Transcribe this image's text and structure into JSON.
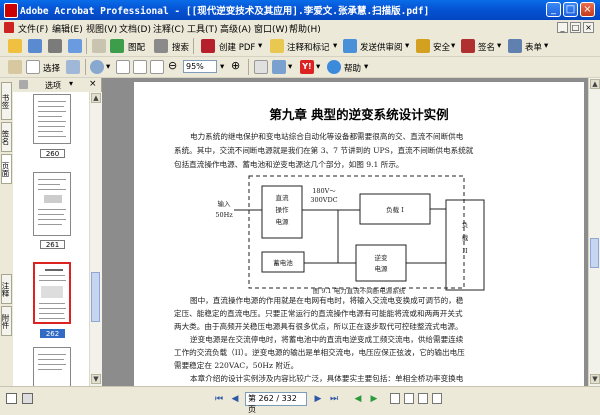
{
  "window": {
    "title": "Adobe Acrobat Professional - [[现代逆变技术及其应用].李爱文.张承慧.扫描版.pdf]",
    "minimize": "_",
    "maximize": "□",
    "close": "×"
  },
  "menus": [
    "文件(F)",
    "编辑(E)",
    "视图(V)",
    "文档(D)",
    "注释(C)",
    "工具(T)",
    "高级(A)",
    "窗口(W)",
    "帮助(H)"
  ],
  "mdi": {
    "minimize": "_",
    "restore": "□",
    "close": "×"
  },
  "toolbar1": {
    "create_pdf": "创建 PDF",
    "comment": "注释和标记",
    "send_review": "发送供审阅",
    "secure": "安全",
    "sign": "签名",
    "forms": "表单",
    "organize": "图配",
    "search": "搜索"
  },
  "toolbar2": {
    "select": "选择",
    "zoom_value": "95%",
    "help": "帮助"
  },
  "side_tabs": [
    "书签",
    "签名",
    "页面",
    "注释",
    "附件"
  ],
  "panel": {
    "options": "选项"
  },
  "thumbnails": [
    {
      "label": "260"
    },
    {
      "label": "261"
    },
    {
      "label": "262",
      "selected": true
    }
  ],
  "page": {
    "title": "第九章   典型的逆变系统设计实例",
    "para1": [
      "电力系统的继电保护和变电站综合自动化等设备都需要很高的交、直流不间断供电",
      "系统。其中，交流不间断电源就是我们在第 3、7 节讲到的 UPS，直流不间断供电系统就",
      "包括直流操作电源、蓄电池和逆变电源这几个部分，如图 9.1 所示。"
    ],
    "diagram": {
      "input": [
        "输入",
        "50Hz"
      ],
      "operate": [
        "直流",
        "操作",
        "电源"
      ],
      "voltage": [
        "180V～",
        "300VDC"
      ],
      "load1": "负载 I",
      "battery": "蓄电池",
      "inverter": [
        "逆变",
        "电源"
      ],
      "load2": [
        "负",
        "载",
        "II"
      ]
    },
    "caption": "图 9.1    电力直流不间断电源系统",
    "para2": [
      "图中，直流操作电源的作用就是在电网有电时，将输入交流电变换成可调节的，稳",
      "定压、能稳定的直流电压。只要正常运行的直流操作电源有可能能将流或和两两开关式",
      "两大类。由于高频开关稳压电源具有很多优点，所以正在逐步取代可控硅整流式电源。",
      "逆变电源是在交流停电时，将蓄电池中的直流电逆变成工频交流电，供给需要连续",
      "工作的交流负载（II）。逆变电源的输出是单相交流电，电压应保正弦波，它的输出电压",
      "需要稳定在 220VAC，50Hz 附近。",
      "本章介绍的设计实例涉及内容比较广泛，具体要实主要包括：单相全桥功率变换电"
    ]
  },
  "status": {
    "page_display": "第 262 / 332 页"
  },
  "colors": {
    "titlebar": "#0552d2",
    "selected_page": "#316ac5",
    "accent_red": "#dd2222"
  }
}
